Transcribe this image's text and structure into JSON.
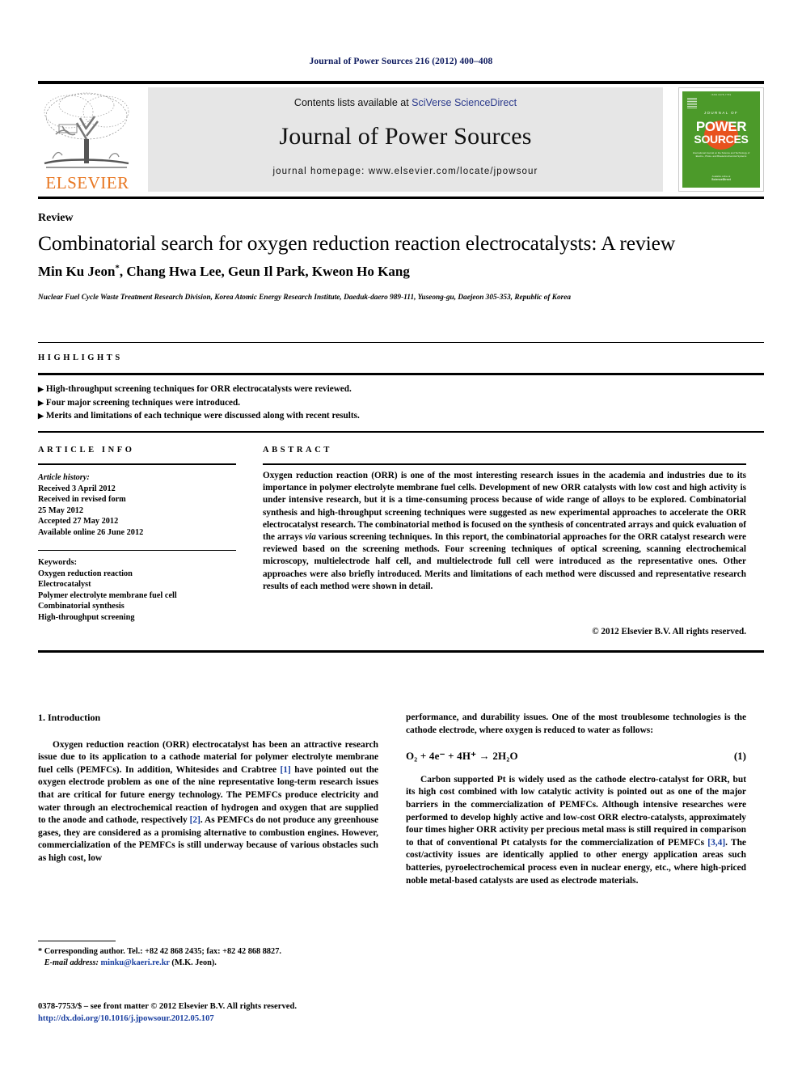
{
  "running_head": "Journal of Power Sources 216 (2012) 400–408",
  "masthead": {
    "contents_prefix": "Contents lists available at ",
    "sciencedirect_link": "SciVerse ScienceDirect",
    "journal_title": "Journal of Power Sources",
    "homepage": "journal homepage: www.elsevier.com/locate/jpowsour",
    "publisher_name": "ELSEVIER",
    "cover": {
      "top_line": "ISSN 0378-7753",
      "journal_of": "JOURNAL OF",
      "power": "POWER",
      "sources": "SOURCES",
      "subtitle": "International Journal on the Science and Technology of Electro-, Photo- and Bioelectrochemical Systems",
      "foot_small": "Available online at",
      "foot_bold": "ScienceDirect"
    },
    "colors": {
      "cover_green": "#4c9a2a",
      "cover_orange": "#e8521e",
      "elsevier_orange": "#e87722",
      "link_blue": "#2b3a8c",
      "band_gray": "#e6e6e6"
    }
  },
  "article": {
    "doctype": "Review",
    "title": "Combinatorial search for oxygen reduction reaction electrocatalysts: A review",
    "authors": "Min Ku Jeon, Chang Hwa Lee, Geun Il Park, Kweon Ho Kang",
    "corresponding_marker": "*",
    "affiliation": "Nuclear Fuel Cycle Waste Treatment Research Division, Korea Atomic Energy Research Institute, Daeduk-daero 989-111, Yuseong-gu, Daejeon 305-353, Republic of Korea"
  },
  "highlights": {
    "label": "HIGHLIGHTS",
    "items": [
      "High-throughput screening techniques for ORR electrocatalysts were reviewed.",
      "Four major screening techniques were introduced.",
      "Merits and limitations of each technique were discussed along with recent results."
    ]
  },
  "article_info": {
    "label": "ARTICLE INFO",
    "history_label": "Article history:",
    "history": [
      "Received 3 April 2012",
      "Received in revised form",
      "25 May 2012",
      "Accepted 27 May 2012",
      "Available online 26 June 2012"
    ],
    "keywords_label": "Keywords:",
    "keywords": [
      "Oxygen reduction reaction",
      "Electrocatalyst",
      "Polymer electrolyte membrane fuel cell",
      "Combinatorial synthesis",
      "High-throughput screening"
    ]
  },
  "abstract": {
    "label": "ABSTRACT",
    "text_part_1": "Oxygen reduction reaction (ORR) is one of the most interesting research issues in the academia and industries due to its importance in polymer electrolyte membrane fuel cells. Development of new ORR catalysts with low cost and high activity is under intensive research, but it is a time-consuming process because of wide range of alloys to be explored. Combinatorial synthesis and high-throughput screening techniques were suggested as new experimental approaches to accelerate the ORR electrocatalyst research. The combinatorial method is focused on the synthesis of concentrated arrays and quick evaluation of the arrays ",
    "italic_via": "via",
    "text_part_2": " various screening techniques. In this report, the combinatorial approaches for the ORR catalyst research were reviewed based on the screening methods. Four screening techniques of optical screening, scanning electrochemical microscopy, multielectrode half cell, and multielectrode full cell were introduced as the representative ones. Other approaches were also briefly introduced. Merits and limitations of each method were discussed and representative research results of each method were shown in detail.",
    "copyright": "© 2012 Elsevier B.V. All rights reserved."
  },
  "body": {
    "section_number_title": "1. Introduction",
    "left_paragraph_part_1": "Oxygen reduction reaction (ORR) electrocatalyst has been an attractive research issue due to its application to a cathode material for polymer electrolyte membrane fuel cells (PEMFCs). In addition, Whitesides and Crabtree ",
    "ref_1": "[1]",
    "left_paragraph_part_2": " have pointed out the oxygen electrode problem as one of the nine representative long-term research issues that are critical for future energy technology. The PEMFCs produce electricity and water through an electrochemical reaction of hydrogen and oxygen that are supplied to the anode and cathode, respectively ",
    "ref_2": "[2]",
    "left_paragraph_part_3": ". As PEMFCs do not produce any greenhouse gases, they are considered as a promising alternative to combustion engines. However, commercialization of the PEMFCs is still underway because of various obstacles such as high cost, low",
    "right_paragraph_1": "performance, and durability issues. One of the most troublesome technologies is the cathode electrode, where oxygen is reduced to water as follows:",
    "equation": "O₂ + 4e⁻ + 4H⁺ → 2H₂O",
    "equation_number": "(1)",
    "right_paragraph_2_part_1": "Carbon supported Pt is widely used as the cathode electro-catalyst for ORR, but its high cost combined with low catalytic activity is pointed out as one of the major barriers in the commercialization of PEMFCs. Although intensive researches were performed to develop highly active and low-cost ORR electro-catalysts, approximately four times higher ORR activity per precious metal mass is still required in comparison to that of conventional Pt catalysts for the commercialization of PEMFCs ",
    "ref_34": "[3,4]",
    "right_paragraph_2_part_2": ". The cost/activity issues are identically applied to other energy application areas such batteries, pyroelectrochemical process even in nuclear energy, etc., where high-priced noble metal-based catalysts are used as electrode materials."
  },
  "footer": {
    "corresponding_note": "* Corresponding author. Tel.: +82 42 868 2435; fax: +82 42 868 8827.",
    "email_label": "E-mail address:",
    "email": "minku@kaeri.re.kr",
    "email_owner": "(M.K. Jeon).",
    "issn_line": "0378-7753/$ – see front matter © 2012 Elsevier B.V. All rights reserved.",
    "doi_line": "http://dx.doi.org/10.1016/j.jpowsour.2012.05.107"
  }
}
